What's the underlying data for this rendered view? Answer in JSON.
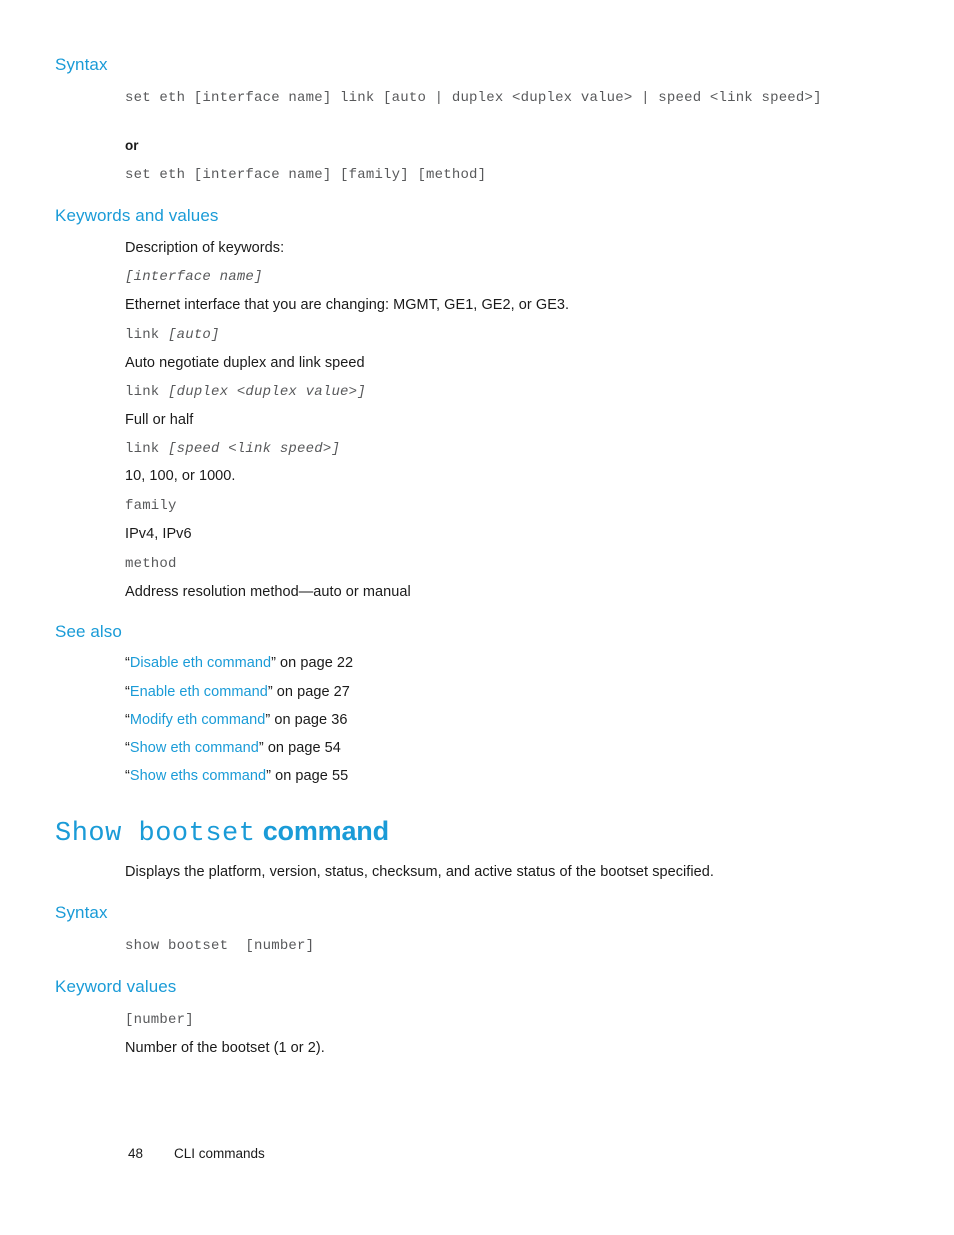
{
  "page": {
    "number": "48",
    "footer_title": "CLI commands"
  },
  "sections": {
    "syntax_1": {
      "heading": "Syntax",
      "line_1": "set eth [interface name] link [auto | duplex <duplex value> | speed <link speed>]",
      "connector": "or",
      "line_2": "set eth [interface name] [family] [method]"
    },
    "keywords_and_values": {
      "heading": "Keywords and values",
      "intro": "Description of keywords:",
      "entries": [
        {
          "term_roman": "",
          "term_italic": "[interface name]",
          "description": "Ethernet interface that you are changing: MGMT, GE1, GE2, or GE3."
        },
        {
          "term_roman": "link ",
          "term_italic": "[auto]",
          "description": "Auto negotiate duplex and link speed"
        },
        {
          "term_roman": "link ",
          "term_italic": "[duplex <duplex value>]",
          "description": "Full or half"
        },
        {
          "term_roman": "link ",
          "term_italic": "[speed <link speed>]",
          "description": "10, 100, or 1000."
        },
        {
          "term_roman": "family",
          "term_italic": "",
          "description": "IPv4, IPv6"
        },
        {
          "term_roman": "method",
          "term_italic": "",
          "description": "Address resolution method—auto or manual"
        }
      ]
    },
    "see_also": {
      "heading": "See also",
      "references": [
        {
          "open_quote": "“",
          "link_text": "Disable eth command",
          "close_quote": "”",
          "suffix": " on page 22"
        },
        {
          "open_quote": "“",
          "link_text": "Enable eth command",
          "close_quote": "”",
          "suffix": " on page 27"
        },
        {
          "open_quote": "“",
          "link_text": "Modify eth command",
          "close_quote": "”",
          "suffix": " on page 36"
        },
        {
          "open_quote": "“",
          "link_text": "Show eth command",
          "close_quote": "”",
          "suffix": " on page 54"
        },
        {
          "open_quote": "“",
          "link_text": "Show eths command",
          "close_quote": "”",
          "suffix": " on page 55"
        }
      ]
    },
    "show_bootset": {
      "title_mono": "Show bootset",
      "title_word": " command",
      "intro": "Displays the platform, version, status, checksum, and active status of the bootset specified.",
      "syntax_heading": "Syntax",
      "syntax_line": "show bootset  [number]",
      "keyword_values_heading": "Keyword values",
      "keyword_term": "[number]",
      "keyword_description": "Number of the bootset (1 or 2)."
    }
  },
  "colors": {
    "heading_blue": "#1a9bd7",
    "link_blue": "#1a9bd7",
    "code_gray": "#58595b",
    "body_black": "#1a1a1a"
  }
}
